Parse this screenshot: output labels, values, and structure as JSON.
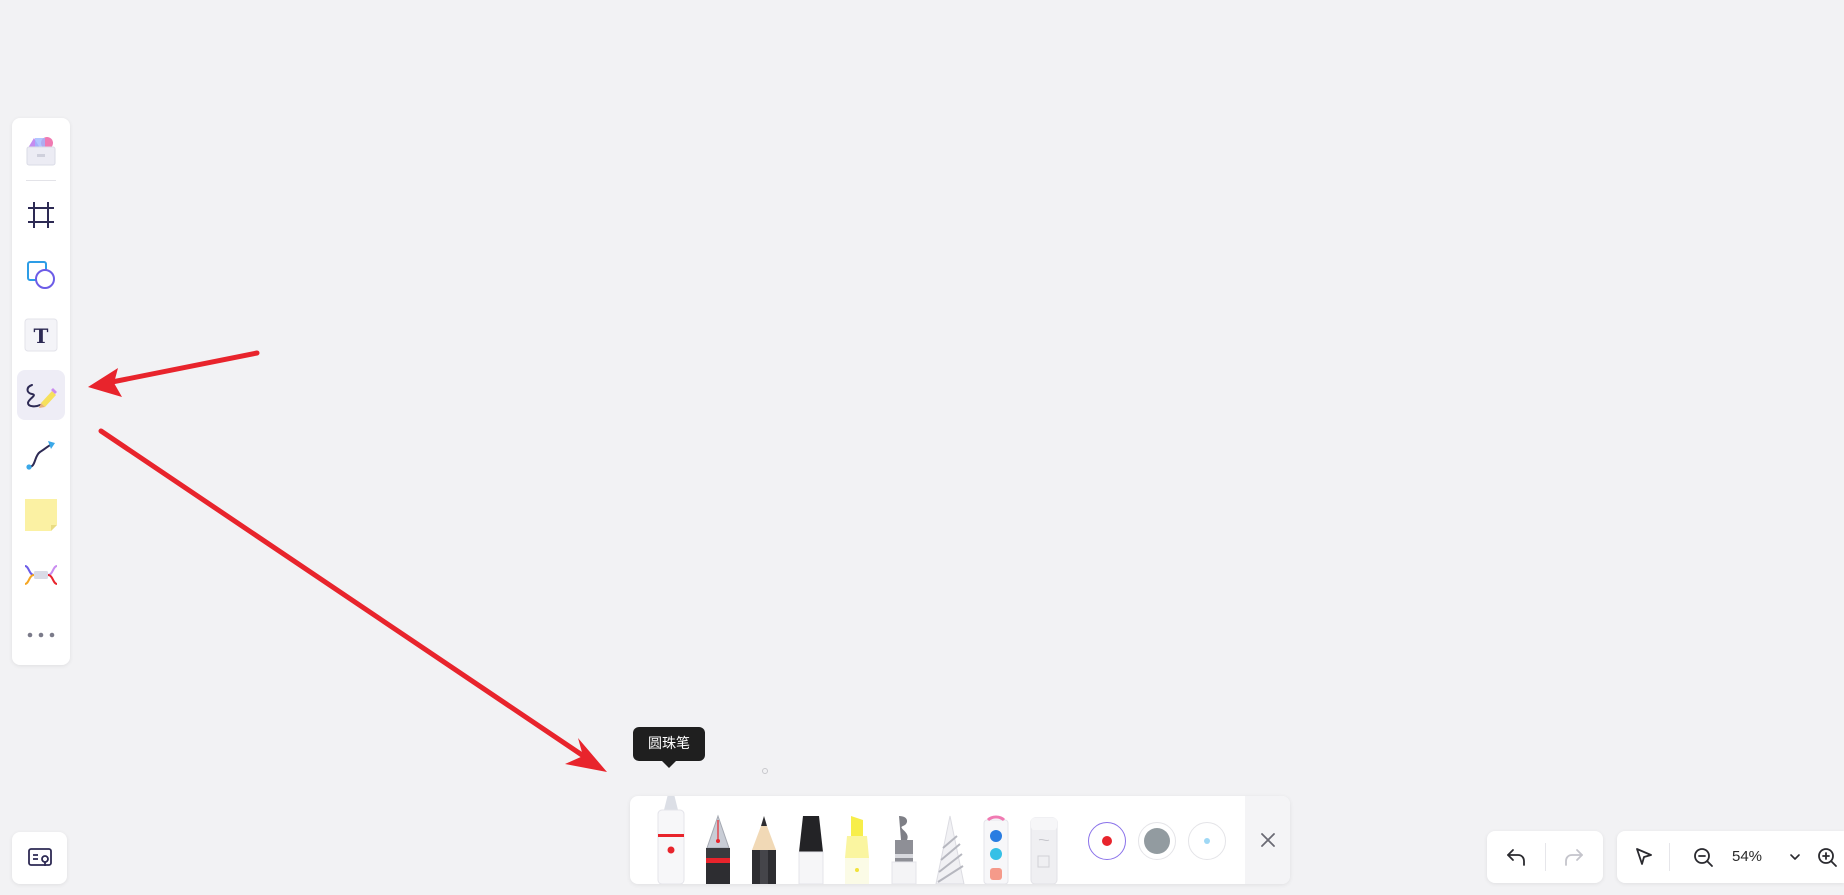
{
  "left_toolbar": {
    "items": [
      {
        "name": "templates",
        "icon": "template-icon"
      },
      {
        "name": "frame",
        "icon": "frame-icon"
      },
      {
        "name": "shape",
        "icon": "shape-icon"
      },
      {
        "name": "text",
        "icon": "text-icon"
      },
      {
        "name": "pen",
        "icon": "pen-icon",
        "active": true
      },
      {
        "name": "connector",
        "icon": "connector-icon"
      },
      {
        "name": "sticky-note",
        "icon": "sticky-note-icon"
      },
      {
        "name": "mind-map",
        "icon": "mind-map-icon"
      },
      {
        "name": "more",
        "icon": "more-icon"
      }
    ],
    "text_glyph": "T"
  },
  "pen_toolbar": {
    "tooltip": "圆珠笔",
    "pens": [
      "ballpoint-pen",
      "fountain-pen",
      "pencil",
      "marker",
      "highlighter",
      "brush",
      "crayon",
      "watercolor",
      "eraser"
    ],
    "selected_pen": "ballpoint-pen",
    "colors": [
      {
        "name": "red",
        "value": "#e8242c",
        "selected": true
      },
      {
        "name": "gray",
        "value": "#929ba0",
        "selected": false
      },
      {
        "name": "light-blue",
        "value": "#9fd8f5",
        "selected": false
      }
    ]
  },
  "zoom": {
    "level": "54%"
  },
  "annotation_color": "#e8242c"
}
